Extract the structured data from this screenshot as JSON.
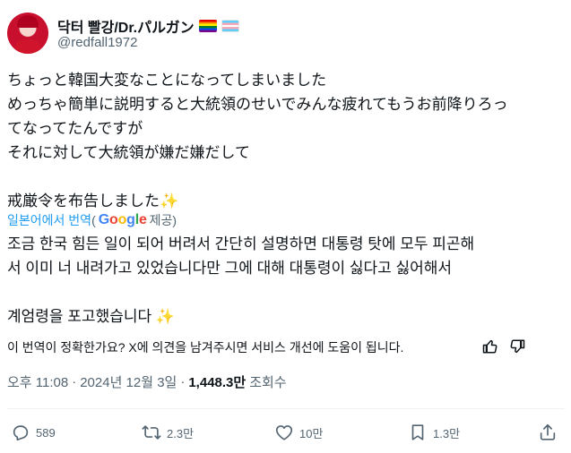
{
  "author": {
    "display_name": "닥터 빨강/Dr.パルガン",
    "handle": "@redfall1972",
    "flags": [
      "rainbow-flag-icon",
      "trans-flag-icon"
    ]
  },
  "tweet": {
    "original_text": "ちょっと韓国大変なことになってしまいました\nめっちゃ簡単に説明すると大統領のせいでみんな疲れてもうお前降りろっ\nてなってたんですが\nそれに対して大統領が嫌だ嫌だして\n\n戒厳令を布告しました",
    "original_sparkle": "✨",
    "translated_from": "일본어에서 번역",
    "provider_open": "(",
    "provider_name": "Google",
    "provider_suffix": " 제공)",
    "translated_text": "조금 한국 힘든 일이 되어 버려서 간단히 설명하면 대통령 탓에 모두 피곤해\n서 이미 너 내려가고 있었습니다만 그에 대해 대통령이 싫다고 싫어해서\n\n계엄령을 포고했습니다 ",
    "translated_sparkle": "✨"
  },
  "feedback": {
    "question": "이 번역이 정확한가요? X에 의견을 남겨주시면 서비스 개선에 도움이 됩니다."
  },
  "meta": {
    "time": "오후 11:08",
    "sep1": "·",
    "date": "2024년 12월 3일",
    "sep2": "·",
    "views_count": "1,448.3만",
    "views_label": "조회수"
  },
  "actions": {
    "replies": "589",
    "reposts": "2.3만",
    "likes": "10만",
    "bookmarks": "1.3만"
  },
  "colors": {
    "text": "#0f1419",
    "secondary": "#536471",
    "link": "#1d9bf0",
    "divider": "#eff3f4"
  }
}
